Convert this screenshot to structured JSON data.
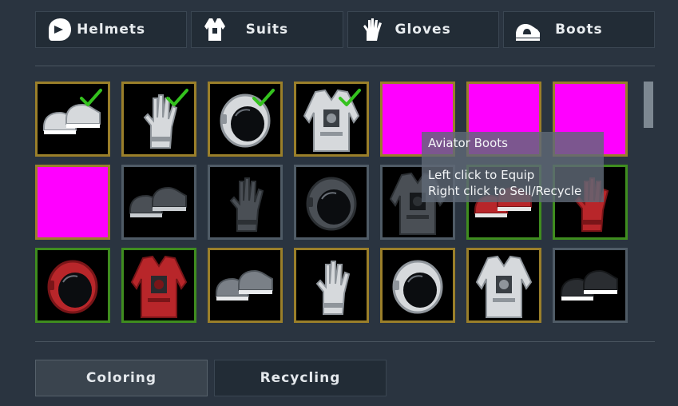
{
  "tabs": [
    {
      "label": "Helmets",
      "icon": "helmet-icon"
    },
    {
      "label": "Suits",
      "icon": "suit-icon"
    },
    {
      "label": "Gloves",
      "icon": "glove-icon"
    },
    {
      "label": "Boots",
      "icon": "boot-icon"
    }
  ],
  "grid": {
    "rows": [
      [
        {
          "item": "boots",
          "color": "white",
          "frame": "gold",
          "equipped": true
        },
        {
          "item": "glove",
          "color": "white",
          "frame": "gold",
          "equipped": true
        },
        {
          "item": "helmet",
          "color": "white",
          "frame": "gold",
          "equipped": true
        },
        {
          "item": "suit",
          "color": "white",
          "frame": "gold",
          "equipped": true
        },
        {
          "item": "placeholder",
          "color": "magenta",
          "frame": "gold",
          "equipped": false
        },
        {
          "item": "placeholder",
          "color": "magenta",
          "frame": "gold",
          "equipped": false
        },
        {
          "item": "placeholder",
          "color": "magenta",
          "frame": "gold",
          "equipped": false
        }
      ],
      [
        {
          "item": "placeholder",
          "color": "magenta",
          "frame": "gold",
          "equipped": false
        },
        {
          "item": "boots",
          "color": "dark",
          "frame": "gray",
          "equipped": false
        },
        {
          "item": "glove",
          "color": "dark",
          "frame": "gray",
          "equipped": false
        },
        {
          "item": "helmet",
          "color": "dark",
          "frame": "gray",
          "equipped": false
        },
        {
          "item": "suit",
          "color": "dark",
          "frame": "gray",
          "equipped": false
        },
        {
          "item": "boots",
          "color": "red",
          "frame": "green",
          "equipped": false
        },
        {
          "item": "glove",
          "color": "red",
          "frame": "green",
          "equipped": false
        }
      ],
      [
        {
          "item": "helmet",
          "color": "red",
          "frame": "green",
          "equipped": false
        },
        {
          "item": "suit",
          "color": "red",
          "frame": "green",
          "equipped": false
        },
        {
          "item": "boots",
          "color": "gray",
          "frame": "gold",
          "equipped": false
        },
        {
          "item": "glove",
          "color": "white",
          "frame": "gold",
          "equipped": false
        },
        {
          "item": "helmet",
          "color": "white",
          "frame": "gold",
          "equipped": false
        },
        {
          "item": "suit",
          "color": "white",
          "frame": "gold",
          "equipped": false
        },
        {
          "item": "boots",
          "color": "black-white",
          "frame": "gray",
          "equipped": false
        }
      ]
    ]
  },
  "tooltip": {
    "title": "Aviator Boots",
    "line1": "Left click to Equip",
    "line2": "Right click to Sell/Recycle"
  },
  "buttons": {
    "coloring": "Coloring",
    "recycling": "Recycling"
  },
  "colors": {
    "background": "#2a3440",
    "frame_gold": "#9a7f2a",
    "frame_green": "#3f8d1f",
    "frame_gray": "#4f5b66",
    "check_green": "#34c21e",
    "placeholder": "#ff00ff"
  }
}
